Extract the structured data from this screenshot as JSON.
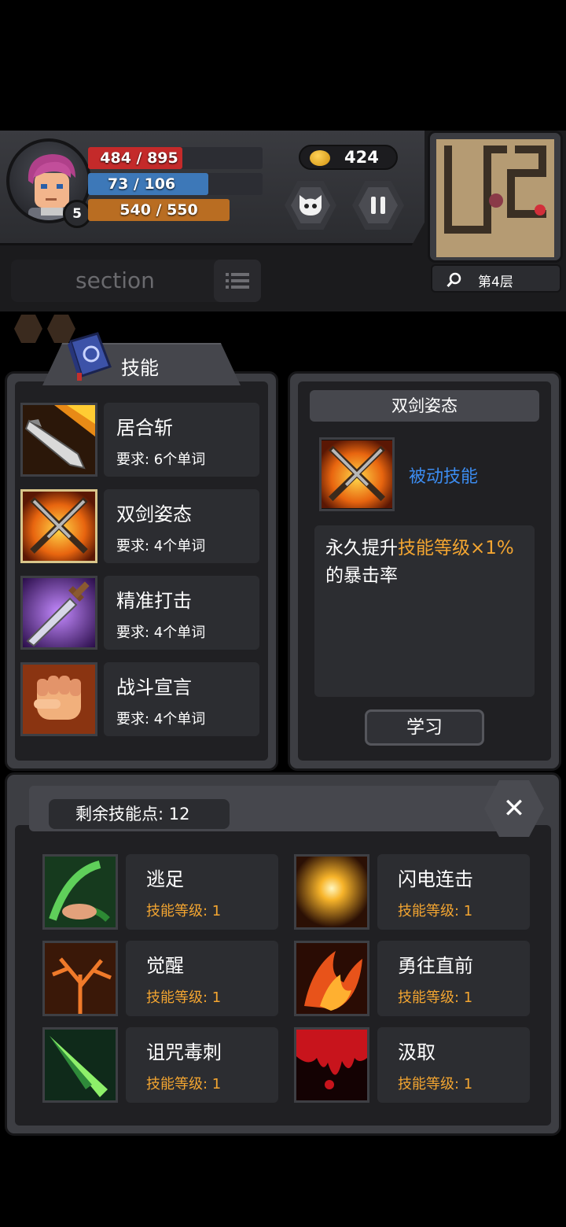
{
  "hud": {
    "level": "5",
    "hp": "484 / 895",
    "mp": "73 / 106",
    "xp": "540 / 550",
    "gold": "424",
    "floor": "第4层"
  },
  "section": {
    "label": "section"
  },
  "skills_panel": {
    "title": "技能",
    "skills": [
      {
        "name": "居合斩",
        "req": "要求: 6个单词"
      },
      {
        "name": "双剑姿态",
        "req": "要求: 4个单词"
      },
      {
        "name": "精准打击",
        "req": "要求: 4个单词"
      },
      {
        "name": "战斗宣言",
        "req": "要求: 4个单词"
      }
    ]
  },
  "detail": {
    "title": "双剑姿态",
    "type": "被动技能",
    "desc_part1": "永久提升",
    "desc_highlight": "技能等级×1%",
    "desc_part2": "的暴击率",
    "learn": "学习"
  },
  "points": {
    "label": "剩余技能点: 12"
  },
  "close": "✕",
  "learned": [
    {
      "name": "逃足",
      "level": "技能等级: 1"
    },
    {
      "name": "闪电连击",
      "level": "技能等级: 1"
    },
    {
      "name": "觉醒",
      "level": "技能等级: 1"
    },
    {
      "name": "勇往直前",
      "level": "技能等级: 1"
    },
    {
      "name": "诅咒毒刺",
      "level": "技能等级: 1"
    },
    {
      "name": "汲取",
      "level": "技能等级: 1"
    }
  ]
}
